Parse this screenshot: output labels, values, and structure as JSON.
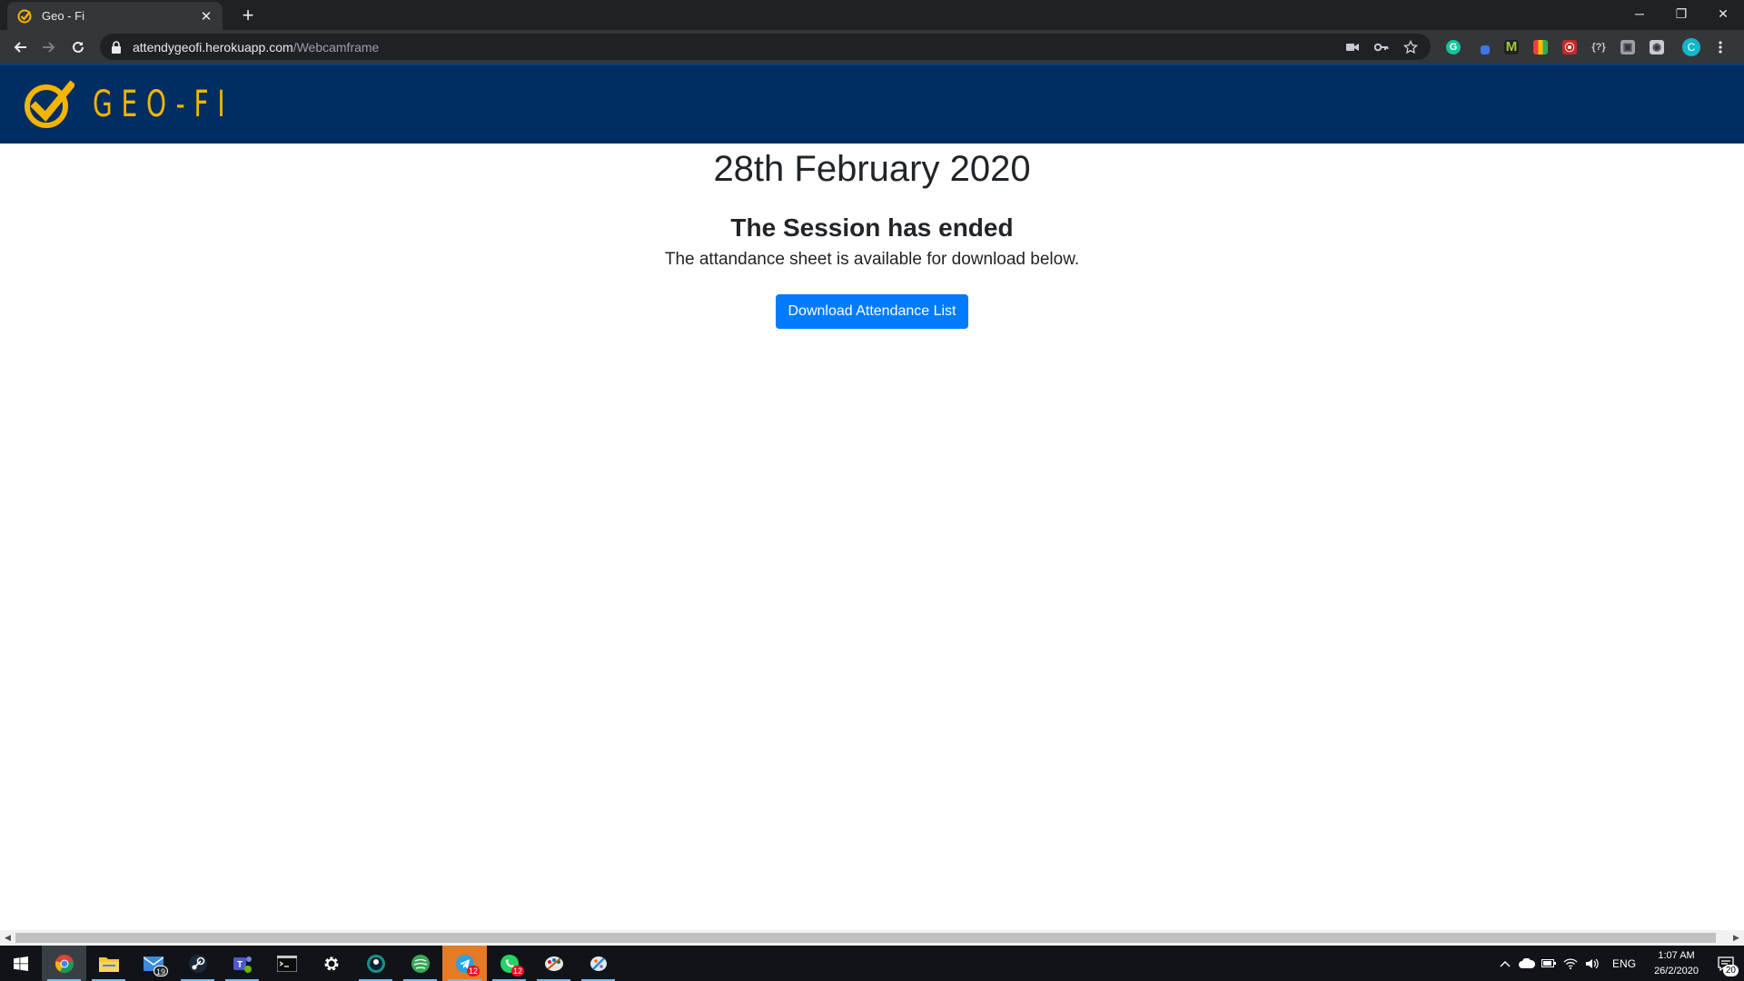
{
  "browser": {
    "tab": {
      "title": "Geo - Fi",
      "close_glyph": "✕"
    },
    "new_tab_glyph": "+",
    "window_controls": {
      "minimize": "─",
      "restore": "❐",
      "close": "✕"
    },
    "url_host": "attendygeofi.herokuapp.com",
    "url_path": "/Webcamframe"
  },
  "site": {
    "logo_text": "GEO-FI",
    "brand_color": "#f4b400",
    "header_color": "#002d62"
  },
  "main": {
    "date": "28th February 2020",
    "session_status": "The Session has ended",
    "subtext": "The attandance sheet is available for download below.",
    "download_button": "Download Attendance List"
  },
  "taskbar": {
    "apps": [
      {
        "name": "chrome",
        "badge": ""
      },
      {
        "name": "file-explorer",
        "badge": ""
      },
      {
        "name": "mail",
        "badge": "19"
      },
      {
        "name": "steam",
        "badge": ""
      },
      {
        "name": "teams",
        "badge": ""
      },
      {
        "name": "terminal",
        "badge": ""
      },
      {
        "name": "settings",
        "badge": ""
      },
      {
        "name": "gitkraken",
        "badge": ""
      },
      {
        "name": "spotify-like",
        "badge": ""
      },
      {
        "name": "telegram",
        "badge": "12"
      },
      {
        "name": "whatsapp",
        "badge": "12"
      },
      {
        "name": "paint",
        "badge": ""
      },
      {
        "name": "paint-3d",
        "badge": ""
      }
    ],
    "tray": {
      "language": "ENG",
      "time": "1:07 AM",
      "date": "26/2/2020",
      "notifications": "20"
    }
  }
}
